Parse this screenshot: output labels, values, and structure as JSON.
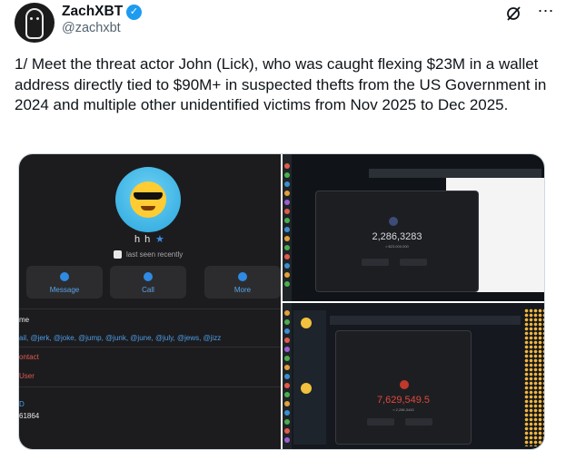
{
  "author": {
    "name": "ZachXBT",
    "handle": "@zachxbt",
    "verified_icon": "verified-badge-icon",
    "accent_color": "#1d9bf0"
  },
  "header_icons": [
    "grok-icon",
    "more-icon"
  ],
  "tweet_text": "1/ Meet the threat actor John (Lick), who was caught flexing $23M in a wallet address directly tied to $90M+  in suspected thefts from the US Government in 2024 and multiple other unidentified victims from Nov 2025 to Dec 2025.",
  "media": {
    "telegram_profile": {
      "display_name": "h h",
      "status": "last seen recently",
      "buttons": [
        "Message",
        "Call",
        "More"
      ],
      "rows": [
        {
          "text": "me",
          "style": "normal"
        },
        {
          "text": "ail, @jerk, @joke, @jump, @junk, @june, @july, @jews, @jizz",
          "style": "blue"
        },
        {
          "text": "ontact",
          "style": "red"
        },
        {
          "text": "User",
          "style": "red"
        },
        {
          "text": "D",
          "style": "blue"
        },
        {
          "text": "61864",
          "style": "normal"
        }
      ]
    },
    "screenshot_top": {
      "balance": "2,286,3283",
      "sub_label": "≈ $23,000,000"
    },
    "screenshot_bottom": {
      "balance": "7,629,549.5",
      "sub_label": "≈ 2,286,3443"
    }
  }
}
